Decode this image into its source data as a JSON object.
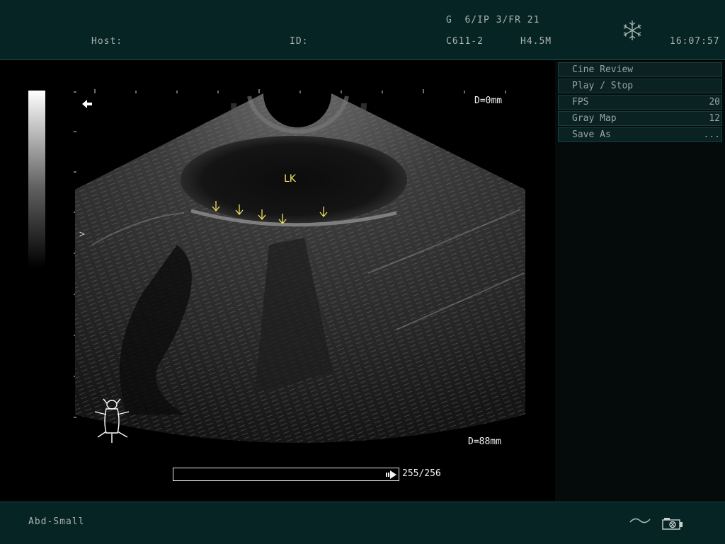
{
  "header": {
    "params": "G  6/IP 3/FR 21",
    "host_label": "Host:",
    "id_label": "ID:",
    "probe": "C611-2",
    "frequency": "H4.5M",
    "time": "16:07:57",
    "freeze_icon": "snowflake-icon"
  },
  "menu": [
    {
      "label": "Cine Review",
      "value": ""
    },
    {
      "label": "Play / Stop",
      "value": ""
    },
    {
      "label": "FPS",
      "value": "20"
    },
    {
      "label": "Gray Map",
      "value": "12"
    },
    {
      "label": "Save As",
      "value": "..."
    }
  ],
  "image": {
    "organ_label": "LK",
    "depth_top": "D=0mm",
    "depth_bottom": "D=88mm",
    "focus_marker": ">",
    "orientation_icon": "arrow-left-icon",
    "body_mark_icon": "dog-body-mark-icon"
  },
  "cine": {
    "frame_counter": "255/256",
    "progress": 0.996
  },
  "footer": {
    "preset": "Abd-Small",
    "icons": [
      "wave-icon",
      "camera-icon"
    ]
  },
  "colors": {
    "bar_bg": "#062424",
    "annotation_yellow": "#f0e060",
    "text_gray": "#a9b3b1"
  }
}
